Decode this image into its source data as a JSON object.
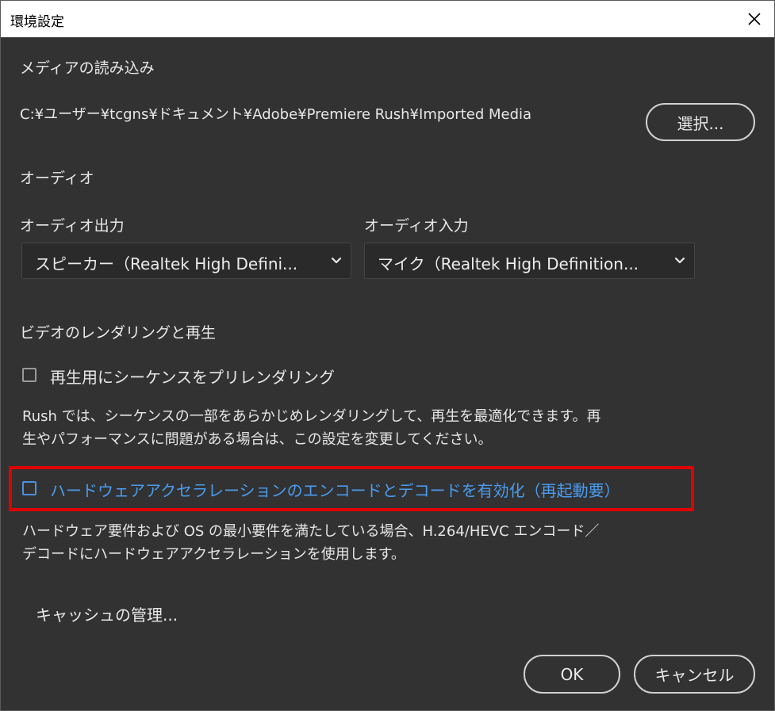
{
  "window": {
    "title": "環境設定"
  },
  "media": {
    "section_label": "メディアの読み込み",
    "path": "C:¥ユーザー¥tcgns¥ドキュメント¥Adobe¥Premiere Rush¥Imported Media",
    "select_button": "選択..."
  },
  "audio": {
    "section_label": "オーディオ",
    "output_label": "オーディオ出力",
    "output_value": "スピーカー（Realtek High Defini...",
    "input_label": "オーディオ入力",
    "input_value": "マイク（Realtek High Definition..."
  },
  "video": {
    "section_label": "ビデオのレンダリングと再生",
    "prerender_label": "再生用にシーケンスをプリレンダリング",
    "prerender_checked": false,
    "prerender_desc_line1": "Rush では、シーケンスの一部をあらかじめレンダリングして、再生を最適化できます。再",
    "prerender_desc_line2": "生やパフォーマンスに問題がある場合は、この設定を変更してください。",
    "hw_accel_label": "ハードウェアアクセラレーションのエンコードとデコードを有効化（再起動要）",
    "hw_accel_checked": false,
    "hw_desc_line1": "ハードウェア要件および OS の最小要件を満たしている場合、H.264/HEVC エンコード／",
    "hw_desc_line2": "デコードにハードウェアアクセラレーションを使用します。"
  },
  "cache": {
    "manage_label": "キャッシュの管理..."
  },
  "footer": {
    "ok_label": "OK",
    "cancel_label": "キャンセル"
  },
  "colors": {
    "dialog_bg": "#323232",
    "highlight": "#e00000",
    "accent_blue": "#4a9cf0"
  }
}
